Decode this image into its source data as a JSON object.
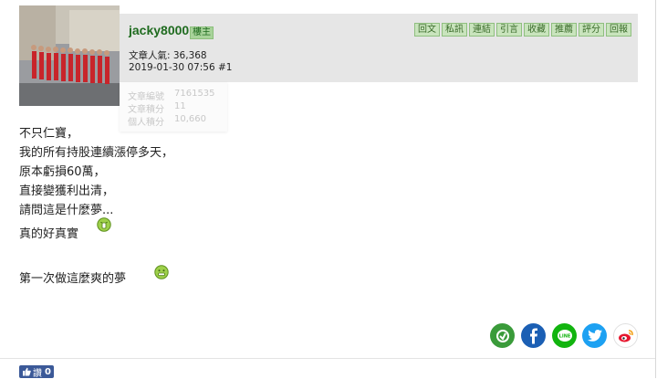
{
  "post": {
    "author": "jacky8000",
    "role_badge": "樓主",
    "popularity": "文章人氣: 36,368",
    "datetime": "2019-01-30 07:56  #1"
  },
  "actions": [
    "回文",
    "私訊",
    "連結",
    "引言",
    "收藏",
    "推薦",
    "評分",
    "回報"
  ],
  "tooltip": {
    "rows": [
      {
        "label": "文章編號",
        "value": "7161535"
      },
      {
        "label": "文章積分",
        "value": "11"
      },
      {
        "label": "個人積分",
        "value": "10,660"
      }
    ]
  },
  "content": {
    "lines": [
      "不只仁寶，",
      "我的所有持股連續漲停多天，",
      "原本虧損60萬，",
      "直接變獲利出清，",
      "請問這是什麼夢...",
      "真的好真實",
      "第一次做這麼爽的夢"
    ]
  },
  "share": [
    {
      "name": "share-other-icon",
      "color": "#3a9b3a"
    },
    {
      "name": "facebook-share-icon",
      "color": "#1b5fb4"
    },
    {
      "name": "line-share-icon",
      "color": "#12b40f"
    },
    {
      "name": "twitter-share-icon",
      "color": "#1da1f2"
    },
    {
      "name": "weibo-share-icon",
      "color": "#e6162d"
    }
  ],
  "like": {
    "label": "讚",
    "count": "0"
  }
}
